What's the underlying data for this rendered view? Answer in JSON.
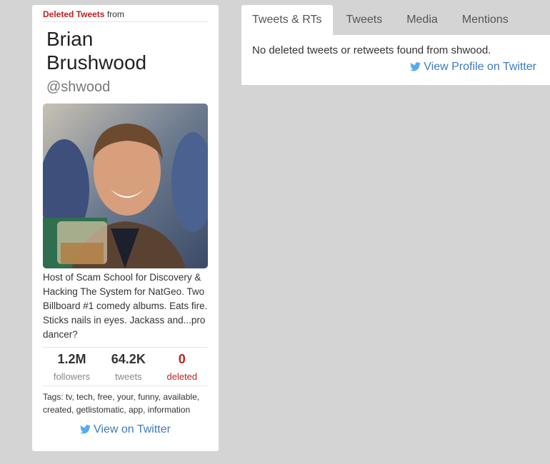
{
  "profile": {
    "deleted_label": "Deleted Tweets",
    "from_label": "from",
    "name_line1": "Brian",
    "name_line2": "Brushwood",
    "handle": "@shwood",
    "photo_alt": "Brian Brushwood",
    "bio": "Host of Scam School for Discovery & Hacking The System for NatGeo. Two Billboard #1 comedy albums. Eats fire. Sticks nails in eyes. Jackass and...pro dancer?",
    "stats": {
      "followers_value": "1.2M",
      "followers_label": "followers",
      "tweets_value": "64.2K",
      "tweets_label": "tweets",
      "deleted_value": "0",
      "deleted_label": "deleted"
    },
    "tags_label": "Tags:",
    "tags": [
      "tv",
      "tech",
      "free",
      "your",
      "funny",
      "available",
      "created",
      "getlistomatic",
      "app",
      "information"
    ],
    "view_twitter": "View on Twitter"
  },
  "tabs": [
    {
      "label": "Tweets & RTs",
      "active": true
    },
    {
      "label": "Tweets",
      "active": false
    },
    {
      "label": "Media",
      "active": false
    },
    {
      "label": "Mentions",
      "active": false
    }
  ],
  "content": {
    "empty_message": "No deleted tweets or retweets found from shwood.",
    "view_profile": "View Profile on Twitter"
  },
  "colors": {
    "background": "#d4d4d4",
    "deleted_red": "#b22222",
    "link_blue": "#3a7bbf",
    "twitter_blue": "#55acee"
  }
}
